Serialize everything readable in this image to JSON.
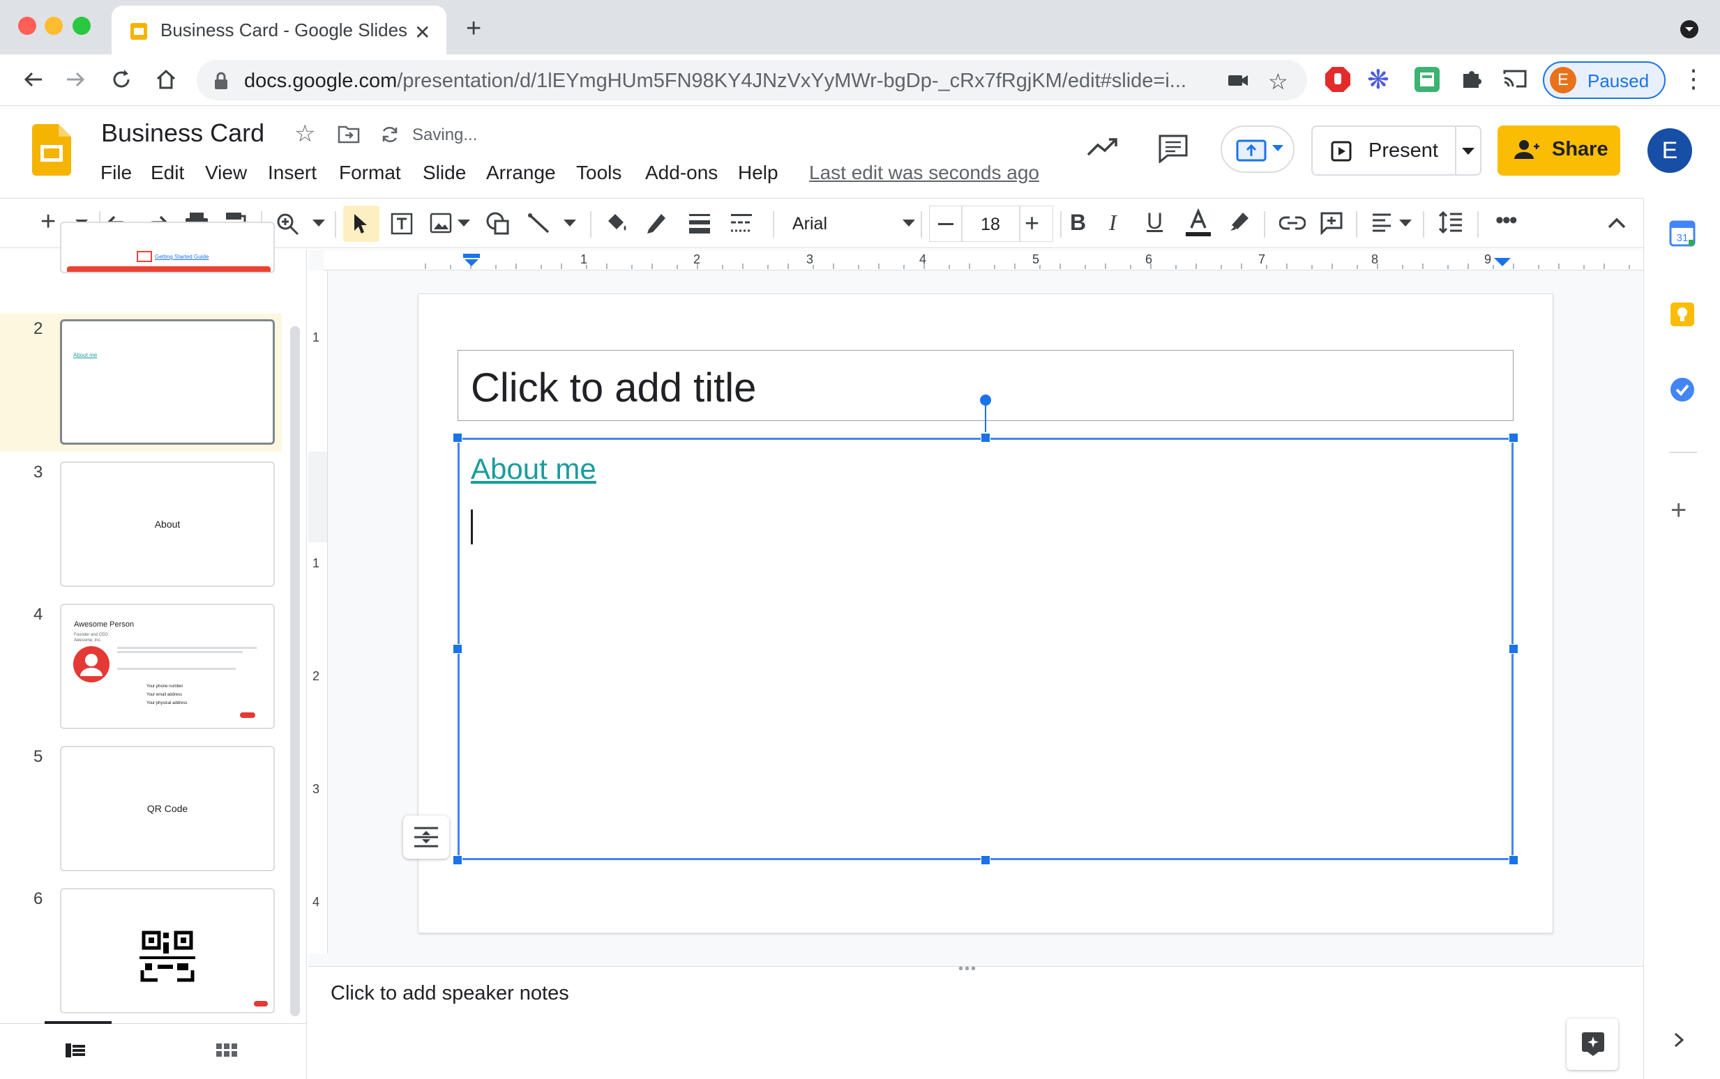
{
  "browser": {
    "tab_title": "Business Card - Google Slides",
    "url_host": "docs.google.com",
    "url_path": "/presentation/d/1lEYmgHUm5FN98KY4JNzVxYyMWr-bgDp-_cRx7fRgjKM/edit#slide=i...",
    "profile_initial": "E",
    "profile_status": "Paused"
  },
  "doc": {
    "title": "Business Card",
    "saving_status": "Saving...",
    "menu": [
      "File",
      "Edit",
      "View",
      "Insert",
      "Format",
      "Slide",
      "Arrange",
      "Tools",
      "Add-ons",
      "Help"
    ],
    "last_edit": "Last edit was seconds ago",
    "present_label": "Present",
    "share_label": "Share",
    "user_initial": "E"
  },
  "toolbar": {
    "font_name": "Arial",
    "font_size": "18"
  },
  "ruler": {
    "h_numbers": [
      "1",
      "2",
      "3",
      "4",
      "5",
      "6",
      "7",
      "8",
      "9"
    ],
    "v_numbers": [
      "1",
      "1",
      "2",
      "3",
      "4"
    ]
  },
  "filmstrip": {
    "slides": [
      {
        "number": "2",
        "text": "About me"
      },
      {
        "number": "3",
        "text": "About"
      },
      {
        "number": "4",
        "title": "Awesome Person",
        "lines": [
          "Founder and CEO",
          "Awesome, Inc.",
          "Your phone number",
          "Your email address",
          "Your physical address"
        ]
      },
      {
        "number": "5",
        "text": "QR Code"
      },
      {
        "number": "6",
        "text": ""
      }
    ],
    "slide1_text": "Getting Started Guide"
  },
  "slide": {
    "title_placeholder": "Click to add title",
    "body_link": "About me"
  },
  "notes": {
    "placeholder": "Click to add speaker notes"
  },
  "colors": {
    "accent": "#1a73e8",
    "share": "#fbbc04",
    "link": "#1a9c9c",
    "selected_slide_bg": "#fef7e0"
  }
}
